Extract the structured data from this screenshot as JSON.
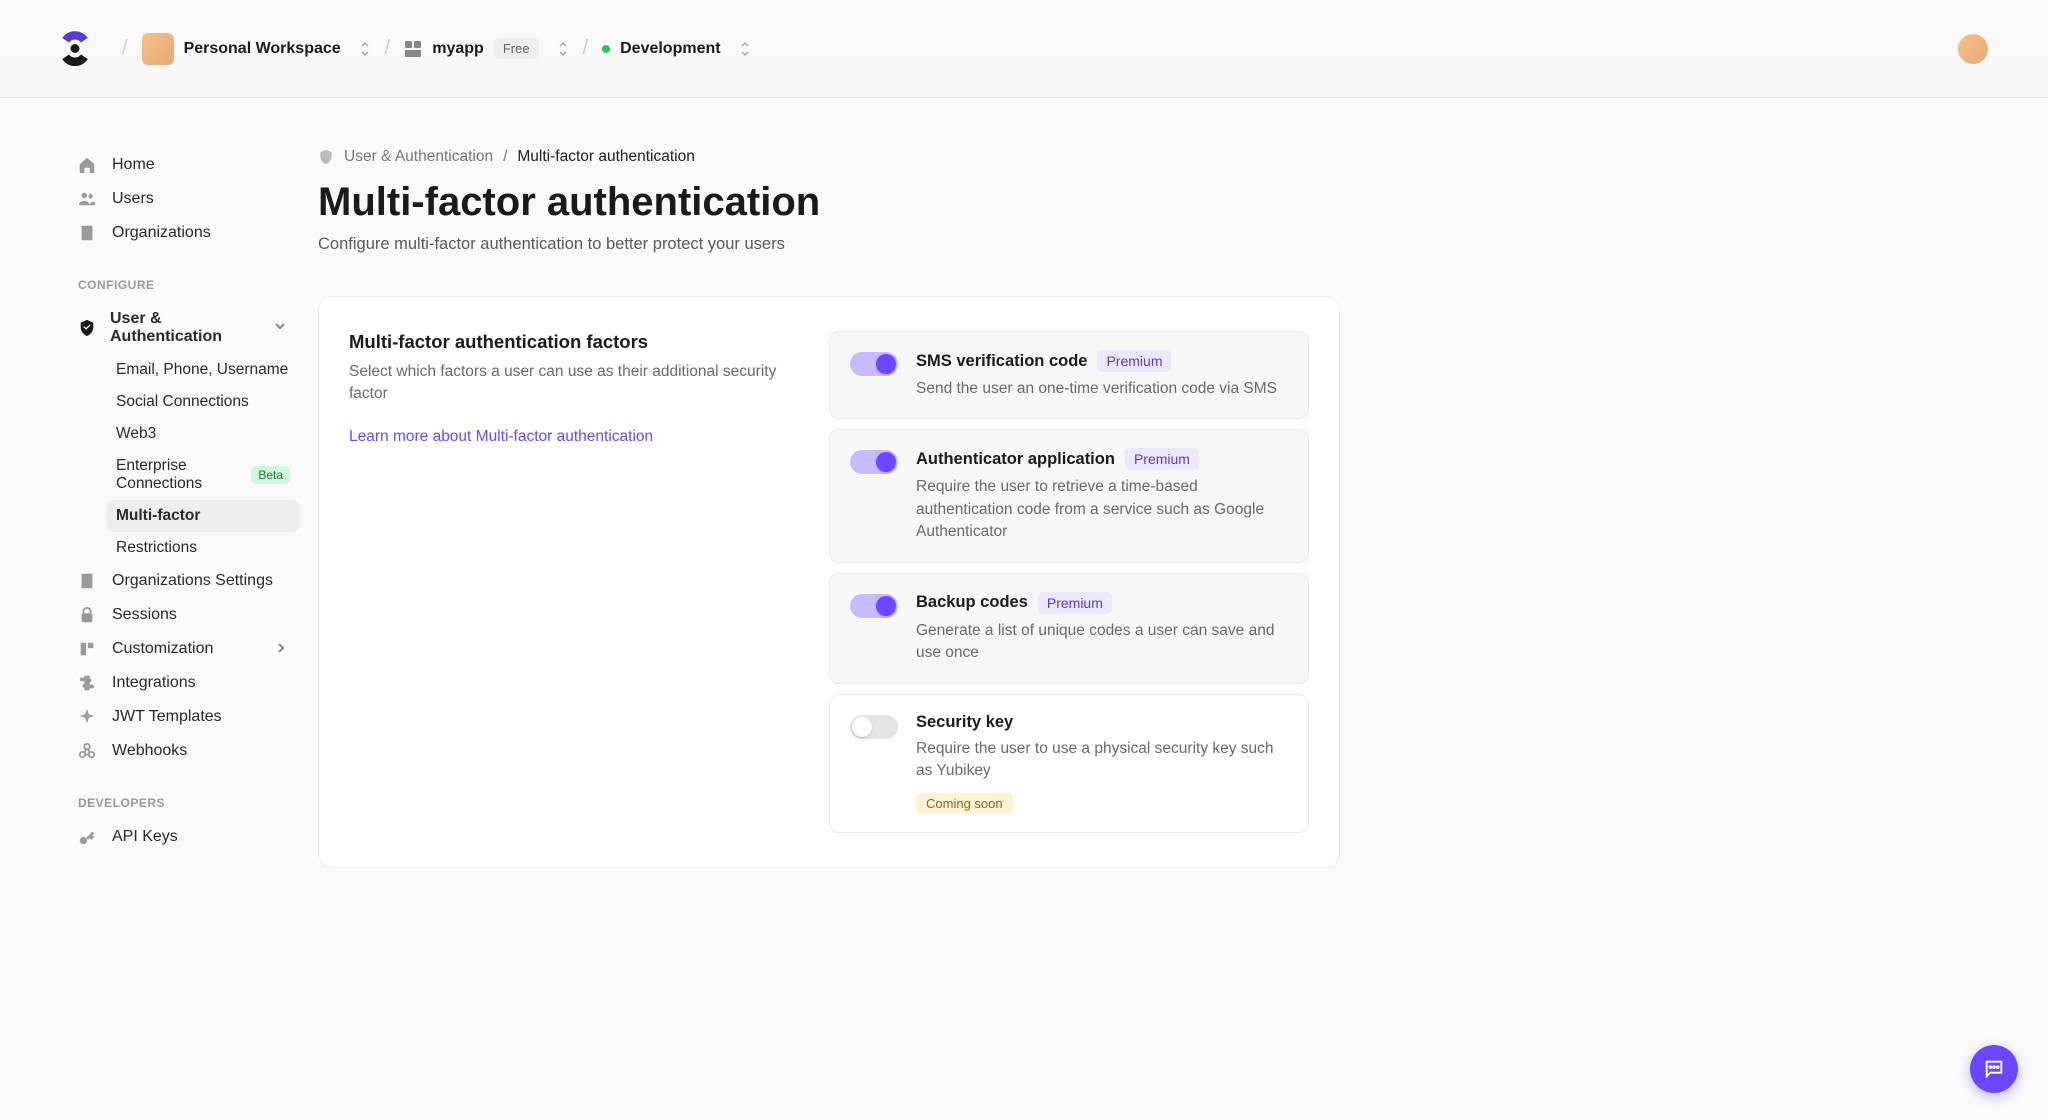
{
  "topbar": {
    "workspace": "Personal Workspace",
    "app_name": "myapp",
    "free_badge": "Free",
    "environment": "Development"
  },
  "sidebar": {
    "top_items": [
      {
        "label": "Home"
      },
      {
        "label": "Users"
      },
      {
        "label": "Organizations"
      }
    ],
    "heading_configure": "CONFIGURE",
    "auth_parent": "User & Authentication",
    "auth_sub": [
      {
        "label": "Email, Phone, Username"
      },
      {
        "label": "Social Connections"
      },
      {
        "label": "Web3"
      },
      {
        "label": "Enterprise Connections",
        "beta": "Beta"
      },
      {
        "label": "Multi-factor",
        "active": true
      },
      {
        "label": "Restrictions"
      }
    ],
    "rest": [
      {
        "label": "Organizations Settings"
      },
      {
        "label": "Sessions"
      },
      {
        "label": "Customization",
        "has_arrow": true
      },
      {
        "label": "Integrations"
      },
      {
        "label": "JWT Templates"
      },
      {
        "label": "Webhooks"
      }
    ],
    "heading_developers": "DEVELOPERS",
    "dev_items": [
      {
        "label": "API Keys"
      }
    ]
  },
  "breadcrumb": {
    "parent": "User & Authentication",
    "current": "Multi-factor authentication"
  },
  "page": {
    "title": "Multi-factor authentication",
    "subtitle": "Configure multi-factor authentication to better protect your users"
  },
  "panel": {
    "title": "Multi-factor authentication factors",
    "description": "Select which factors a user can use as their additional security factor",
    "link": "Learn more about Multi-factor authentication"
  },
  "factors": [
    {
      "title": "SMS verification code",
      "badge": "Premium",
      "desc": "Send the user an one-time verification code via SMS",
      "on": true
    },
    {
      "title": "Authenticator application",
      "badge": "Premium",
      "desc": "Require the user to retrieve a time-based authentication code from a service such as Google Authenticator",
      "on": true
    },
    {
      "title": "Backup codes",
      "badge": "Premium",
      "desc": "Generate a list of unique codes a user can save and use once",
      "on": true
    },
    {
      "title": "Security key",
      "desc": "Require the user to use a physical security key such as Yubikey",
      "on": false,
      "coming": "Coming soon"
    }
  ]
}
